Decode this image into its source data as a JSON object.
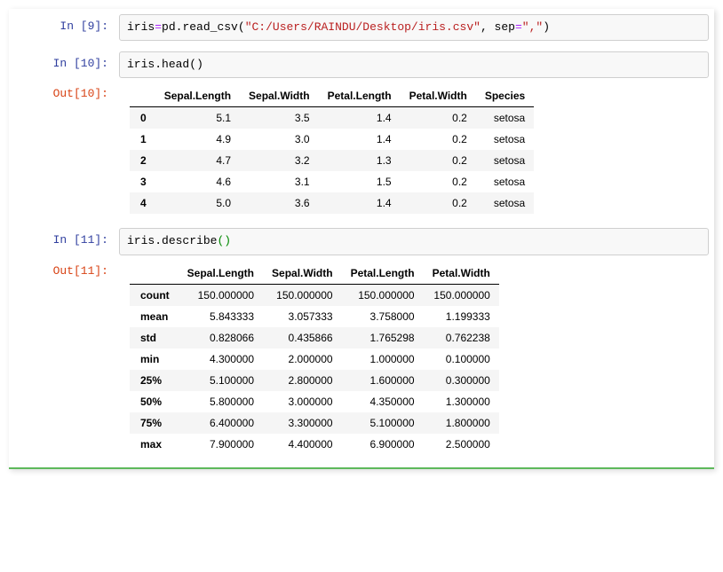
{
  "cells": {
    "c9": {
      "prompt_in": "In  [9]:",
      "code_parts": {
        "var1": "iris",
        "assign": "=",
        "mod": "pd",
        "dot1": ".",
        "func": "read_csv",
        "lparen": "(",
        "str1": "\"C:/Users/RAINDU/Desktop/iris.csv\"",
        "comma": ",",
        "arg": " sep",
        "eq": "=",
        "str2": "\",\"",
        "rparen": ")"
      }
    },
    "c10": {
      "prompt_in": "In [10]:",
      "prompt_out": "Out[10]:",
      "code_parts": {
        "var1": "iris",
        "dot1": ".",
        "func": "head",
        "lparen": "(",
        "rparen": ")"
      },
      "table": {
        "headers": [
          "",
          "Sepal.Length",
          "Sepal.Width",
          "Petal.Length",
          "Petal.Width",
          "Species"
        ],
        "rows": [
          [
            "0",
            "5.1",
            "3.5",
            "1.4",
            "0.2",
            "setosa"
          ],
          [
            "1",
            "4.9",
            "3.0",
            "1.4",
            "0.2",
            "setosa"
          ],
          [
            "2",
            "4.7",
            "3.2",
            "1.3",
            "0.2",
            "setosa"
          ],
          [
            "3",
            "4.6",
            "3.1",
            "1.5",
            "0.2",
            "setosa"
          ],
          [
            "4",
            "5.0",
            "3.6",
            "1.4",
            "0.2",
            "setosa"
          ]
        ]
      }
    },
    "c11": {
      "prompt_in": "In [11]:",
      "prompt_out": "Out[11]:",
      "code_parts": {
        "var1": "iris",
        "dot1": ".",
        "func": "describe",
        "lparen": "(",
        "rparen": ")"
      },
      "table": {
        "headers": [
          "",
          "Sepal.Length",
          "Sepal.Width",
          "Petal.Length",
          "Petal.Width"
        ],
        "rows": [
          [
            "count",
            "150.000000",
            "150.000000",
            "150.000000",
            "150.000000"
          ],
          [
            "mean",
            "5.843333",
            "3.057333",
            "3.758000",
            "1.199333"
          ],
          [
            "std",
            "0.828066",
            "0.435866",
            "1.765298",
            "0.762238"
          ],
          [
            "min",
            "4.300000",
            "2.000000",
            "1.000000",
            "0.100000"
          ],
          [
            "25%",
            "5.100000",
            "2.800000",
            "1.600000",
            "0.300000"
          ],
          [
            "50%",
            "5.800000",
            "3.000000",
            "4.350000",
            "1.300000"
          ],
          [
            "75%",
            "6.400000",
            "3.300000",
            "5.100000",
            "1.800000"
          ],
          [
            "max",
            "7.900000",
            "4.400000",
            "6.900000",
            "2.500000"
          ]
        ]
      }
    }
  },
  "chart_data": [
    {
      "type": "table",
      "title": "iris.head()",
      "columns": [
        "Sepal.Length",
        "Sepal.Width",
        "Petal.Length",
        "Petal.Width",
        "Species"
      ],
      "index": [
        0,
        1,
        2,
        3,
        4
      ],
      "data": [
        [
          5.1,
          3.5,
          1.4,
          0.2,
          "setosa"
        ],
        [
          4.9,
          3.0,
          1.4,
          0.2,
          "setosa"
        ],
        [
          4.7,
          3.2,
          1.3,
          0.2,
          "setosa"
        ],
        [
          4.6,
          3.1,
          1.5,
          0.2,
          "setosa"
        ],
        [
          5.0,
          3.6,
          1.4,
          0.2,
          "setosa"
        ]
      ]
    },
    {
      "type": "table",
      "title": "iris.describe()",
      "columns": [
        "Sepal.Length",
        "Sepal.Width",
        "Petal.Length",
        "Petal.Width"
      ],
      "index": [
        "count",
        "mean",
        "std",
        "min",
        "25%",
        "50%",
        "75%",
        "max"
      ],
      "data": [
        [
          150.0,
          150.0,
          150.0,
          150.0
        ],
        [
          5.843333,
          3.057333,
          3.758,
          1.199333
        ],
        [
          0.828066,
          0.435866,
          1.765298,
          0.762238
        ],
        [
          4.3,
          2.0,
          1.0,
          0.1
        ],
        [
          5.1,
          2.8,
          1.6,
          0.3
        ],
        [
          5.8,
          3.0,
          4.35,
          1.3
        ],
        [
          6.4,
          3.3,
          5.1,
          1.8
        ],
        [
          7.9,
          4.4,
          6.9,
          2.5
        ]
      ]
    }
  ]
}
